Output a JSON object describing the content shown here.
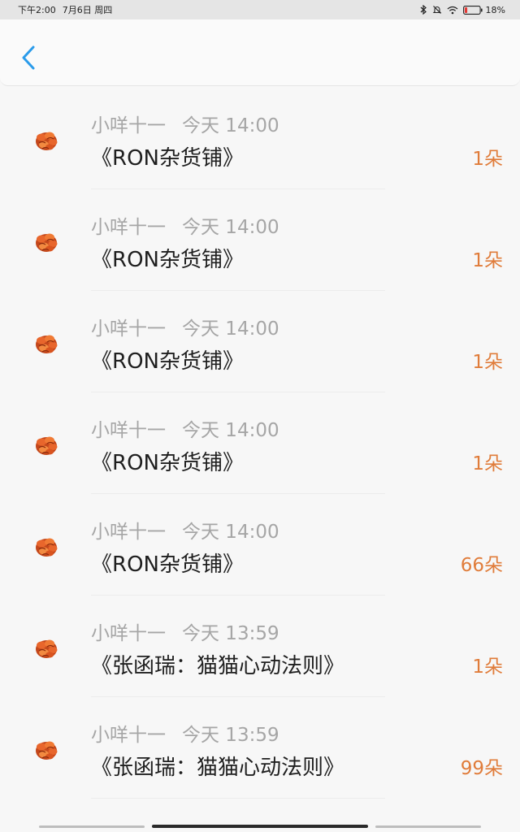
{
  "status_bar": {
    "time": "下午2:00",
    "date": "7月6日 周四",
    "battery_percent": "18%",
    "battery_level": 0.18,
    "icons": [
      "bluetooth-icon",
      "bell-muted-icon",
      "wifi-icon",
      "battery-icon"
    ]
  },
  "header": {
    "back_icon": "chevron-left-icon"
  },
  "colors": {
    "accent": "#e07c3a",
    "back": "#2a9bea",
    "muted": "#a6a6a6"
  },
  "items": [
    {
      "user": "小咩十一",
      "time": "今天 14:00",
      "title": "《RON杂货铺》",
      "amount": "1朵"
    },
    {
      "user": "小咩十一",
      "time": "今天 14:00",
      "title": "《RON杂货铺》",
      "amount": "1朵"
    },
    {
      "user": "小咩十一",
      "time": "今天 14:00",
      "title": "《RON杂货铺》",
      "amount": "1朵"
    },
    {
      "user": "小咩十一",
      "time": "今天 14:00",
      "title": "《RON杂货铺》",
      "amount": "1朵"
    },
    {
      "user": "小咩十一",
      "time": "今天 14:00",
      "title": "《RON杂货铺》",
      "amount": "66朵"
    },
    {
      "user": "小咩十一",
      "time": "今天 13:59",
      "title": "《张函瑞：猫猫心动法则》",
      "amount": "1朵"
    },
    {
      "user": "小咩十一",
      "time": "今天 13:59",
      "title": "《张函瑞：猫猫心动法则》",
      "amount": "99朵"
    }
  ]
}
